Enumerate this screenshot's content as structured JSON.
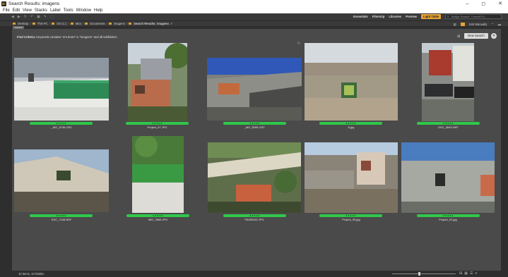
{
  "window": {
    "title": "Search Results: imagens",
    "app_icon": "Br",
    "minimize": "–",
    "maximize": "◻",
    "close": "✕"
  },
  "menu": [
    "File",
    "Edit",
    "View",
    "Stacks",
    "Label",
    "Tools",
    "Window",
    "Help"
  ],
  "toolbar": {
    "workspaces": [
      "Essentials",
      "Filmstrip",
      "Libraries",
      "Preview"
    ],
    "active_workspace": "Light Table",
    "search_placeholder": "Bridge Search: Current Fo..."
  },
  "path": {
    "items": [
      "Desktop",
      "This PC",
      "OS (C:)",
      "Mira",
      "Documents",
      "imagens",
      "Search Results: imagens"
    ],
    "sort_label": "Sort Manually"
  },
  "tab_label": "Content",
  "search": {
    "criteria_label": "Find Criteria:",
    "criteria_text": "Keywords contains \"em bruto\" in \"imagens\" and all subfolders",
    "new_search_label": "New Search",
    "close_label": "✕"
  },
  "rating_text": "★★★★★",
  "thumbnails": [
    {
      "name": "_MG_5746.CR2"
    },
    {
      "name": "Project_07.JPG"
    },
    {
      "name": "_MG_6095.CR2"
    },
    {
      "name": "8.jpg"
    },
    {
      "name": "DSC_3846.NEF"
    },
    {
      "name": "DSC_7108.NEF"
    },
    {
      "name": "IMG_3565.JPG"
    },
    {
      "name": "P8280432.JPG"
    },
    {
      "name": "Project_05.jpg"
    },
    {
      "name": "Project_02.jpg"
    }
  ],
  "status": {
    "text": "10 items, 10 hidden"
  },
  "colors": {
    "accent": "#e8a33a",
    "rating_green": "#2fc84a",
    "panel_bg": "#4a4a4a"
  }
}
